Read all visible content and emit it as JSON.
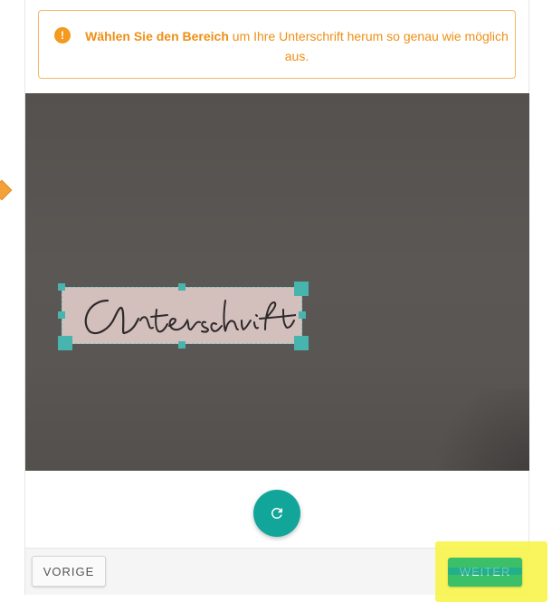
{
  "alert": {
    "icon": "exclamation-icon",
    "bold_text": "Wählen Sie den Bereich",
    "text": " um Ihre Unterschrift herum so genau wie möglich aus.",
    "color": "#ef8f14"
  },
  "image": {
    "signature_text": "Unterschrift"
  },
  "actions": {
    "refresh_icon": "refresh-icon",
    "prev_label": "VORIGE",
    "next_label": "WEITER"
  },
  "colors": {
    "accent": "#12a69a",
    "highlight": "#f7f43f",
    "next_button": "#3cbf69"
  }
}
